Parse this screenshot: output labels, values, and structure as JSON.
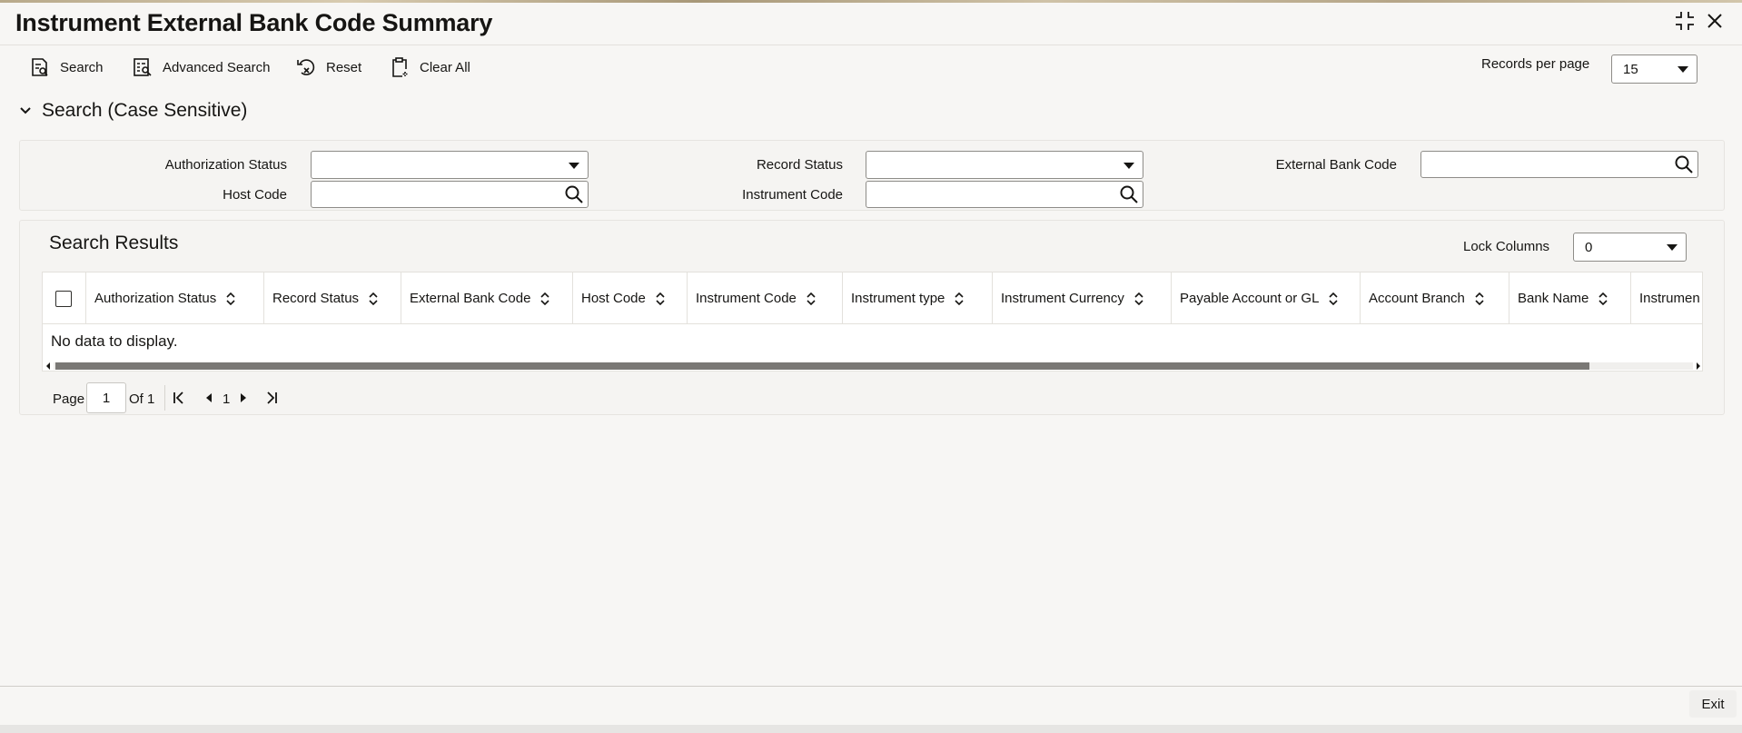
{
  "window": {
    "title": "Instrument External Bank Code Summary",
    "icons": {
      "restore": "collapse-arrows-icon",
      "close": "close-icon"
    }
  },
  "toolbar": {
    "search_label": "Search",
    "advanced_search_label": "Advanced Search",
    "reset_label": "Reset",
    "clear_all_label": "Clear All",
    "records_per_page_label": "Records per page",
    "records_per_page_value": "15"
  },
  "search_section": {
    "heading": "Search (Case Sensitive)",
    "fields": {
      "authorization_status_label": "Authorization Status",
      "authorization_status_value": "",
      "record_status_label": "Record Status",
      "record_status_value": "",
      "external_bank_code_label": "External Bank Code",
      "external_bank_code_value": "",
      "host_code_label": "Host Code",
      "host_code_value": "",
      "instrument_code_label": "Instrument Code",
      "instrument_code_value": ""
    }
  },
  "results": {
    "heading": "Search Results",
    "lock_columns_label": "Lock Columns",
    "lock_columns_value": "0",
    "columns": [
      "Authorization Status",
      "Record Status",
      "External Bank Code",
      "Host Code",
      "Instrument Code",
      "Instrument type",
      "Instrument Currency",
      "Payable Account or GL",
      "Account Branch",
      "Bank Name",
      "Instrumen"
    ],
    "empty_message": "No data to display."
  },
  "pagination": {
    "page_label": "Page",
    "current_page": "1",
    "of_label": "Of 1",
    "page_link": "1"
  },
  "footer": {
    "exit_label": "Exit"
  },
  "colors": {
    "background": "#f7f6f4",
    "text": "#161513",
    "border": "#8e8c88",
    "scroll_thumb": "#7a7875"
  }
}
